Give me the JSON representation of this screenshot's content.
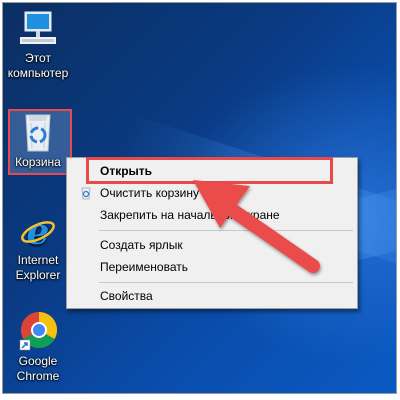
{
  "desktop": {
    "icons": [
      {
        "name": "this-pc",
        "label_line1": "Этот",
        "label_line2": "компьютер",
        "icon": "computer-icon"
      },
      {
        "name": "recycle-bin",
        "label": "Корзина",
        "icon": "recycle-bin-icon",
        "selected": true
      },
      {
        "name": "internet-explorer",
        "label_line1": "Internet",
        "label_line2": "Explorer",
        "icon": "internet-explorer-icon"
      },
      {
        "name": "google-chrome",
        "label_line1": "Google",
        "label_line2": "Chrome",
        "icon": "chrome-icon",
        "shortcut": true
      }
    ]
  },
  "context_menu": {
    "items": [
      {
        "label": "Открыть",
        "bold": true,
        "highlighted": true
      },
      {
        "label": "Очистить корзину",
        "icon": "recycle-bin-small-icon"
      },
      {
        "label": "Закрепить на начальном экране"
      },
      {
        "label": "Создать ярлык"
      },
      {
        "label": "Переименовать"
      },
      {
        "label": "Свойства"
      }
    ]
  },
  "colors": {
    "highlight": "#e84a4a",
    "menu_background": "#f0f0f0",
    "desktop_blue": "#0a4aa6"
  }
}
